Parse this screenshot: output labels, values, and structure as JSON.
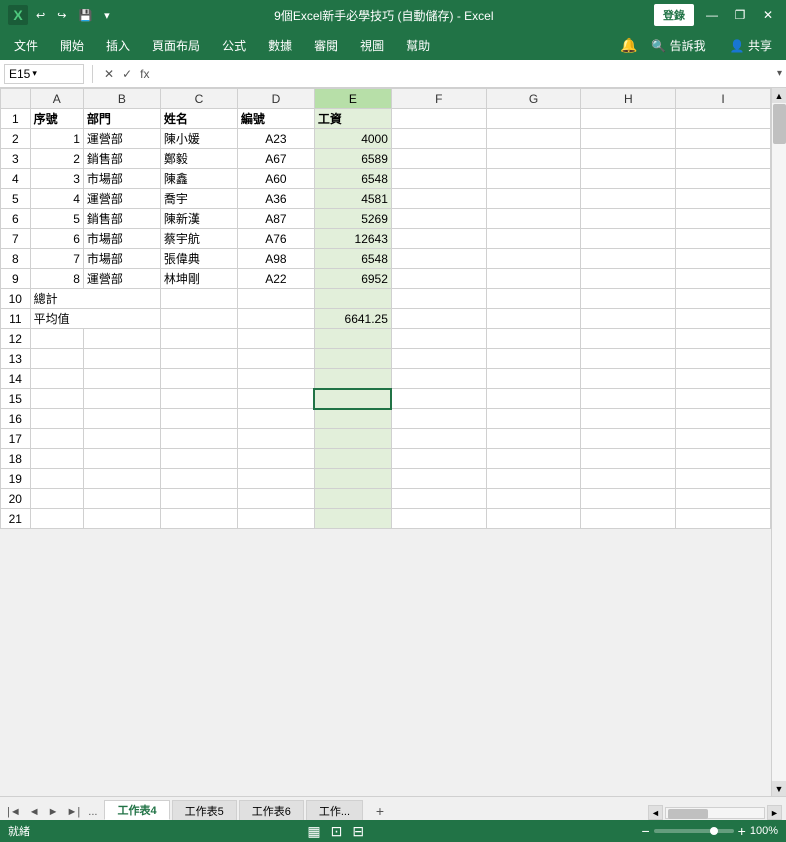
{
  "title": "9個Excel新手必學技巧 (自動儲存) - Excel",
  "titlebar": {
    "login_label": "登錄",
    "minimize": "—",
    "restore": "❐",
    "close": "✕"
  },
  "menu": {
    "items": [
      "文件",
      "開始",
      "插入",
      "頁面布局",
      "公式",
      "數據",
      "審閱",
      "視圖",
      "幫助"
    ],
    "tell_me": "告訴我",
    "share": "共享"
  },
  "formula_bar": {
    "name_box": "E15",
    "formula": ""
  },
  "sheet": {
    "columns": [
      "A",
      "B",
      "C",
      "D",
      "E",
      "F",
      "G",
      "H",
      "I"
    ],
    "rows": [
      1,
      2,
      3,
      4,
      5,
      6,
      7,
      8,
      9,
      10,
      11,
      12,
      13,
      14,
      15,
      16,
      17,
      18,
      19,
      20,
      21
    ],
    "headers": [
      "序號",
      "部門",
      "姓名",
      "編號",
      "工資"
    ],
    "data": [
      [
        1,
        "運營部",
        "陳小媛",
        "A23",
        4000
      ],
      [
        2,
        "銷售部",
        "鄭毅",
        "A67",
        6589
      ],
      [
        3,
        "市場部",
        "陳鑫",
        "A60",
        6548
      ],
      [
        4,
        "運營部",
        "喬宇",
        "A36",
        4581
      ],
      [
        5,
        "銷售部",
        "陳新漢",
        "A87",
        5269
      ],
      [
        6,
        "市場部",
        "蔡宇航",
        "A76",
        12643
      ],
      [
        7,
        "市場部",
        "張偉典",
        "A98",
        6548
      ],
      [
        8,
        "運營部",
        "林坤剛",
        "A22",
        6952
      ]
    ],
    "row10_label": "總計",
    "row11_label": "平均值",
    "row11_value": 6641.25
  },
  "tabs": {
    "sheets": [
      "工作表4",
      "工作表5",
      "工作表6",
      "工作..."
    ],
    "active": "工作表4"
  },
  "status": {
    "mode": "就緒",
    "zoom": "100%"
  }
}
